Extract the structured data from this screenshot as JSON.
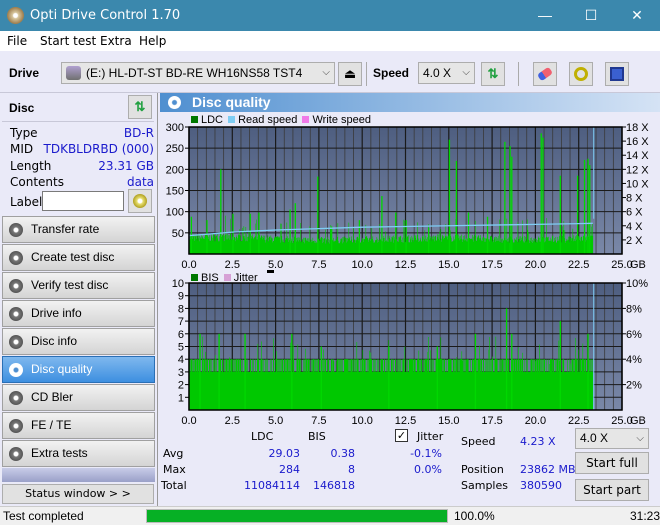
{
  "window": {
    "title": "Opti Drive Control 1.70",
    "minimize": "—",
    "maximize": "☐",
    "close": "✕"
  },
  "menu": [
    "File",
    "Start test",
    "Extra",
    "Help"
  ],
  "toolbar": {
    "drive_label": "Drive",
    "drive_value": "(E:)  HL-DT-ST BD-RE  WH16NS58 TST4",
    "speed_label": "Speed",
    "speed_value": "4.0 X",
    "icons": [
      "eject-icon",
      "refresh-icon",
      "erase-icon",
      "settings-icon",
      "save-icon"
    ]
  },
  "disc": {
    "header": "Disc",
    "type_label": "Type",
    "type_value": "BD-R",
    "mid_label": "MID",
    "mid_value": "TDKBLDRBD (000)",
    "length_label": "Length",
    "length_value": "23.31 GB",
    "contents_label": "Contents",
    "contents_value": "data",
    "label_label": "Label",
    "label_value": ""
  },
  "nav": [
    {
      "label": "Transfer rate",
      "active": false
    },
    {
      "label": "Create test disc",
      "active": false
    },
    {
      "label": "Verify test disc",
      "active": false
    },
    {
      "label": "Drive info",
      "active": false
    },
    {
      "label": "Disc info",
      "active": false
    },
    {
      "label": "Disc quality",
      "active": true
    },
    {
      "label": "CD Bler",
      "active": false
    },
    {
      "label": "FE / TE",
      "active": false
    },
    {
      "label": "Extra tests",
      "active": false
    }
  ],
  "status_window_label": "Status window > >",
  "panel_title": "Disc quality",
  "colors": {
    "ldc": "#00c800",
    "read_speed": "#7ecdf4",
    "write_speed": "#f07ae8",
    "bis": "#00c800",
    "jitter": "#d6a0d6",
    "plot_bg_top": "#4e5e80",
    "plot_bg_bottom": "#7a88a8",
    "accent": "#3d8fe0"
  },
  "chart_data": [
    {
      "type": "bar",
      "title": "LDC / Read speed",
      "legend": [
        "LDC",
        "Read speed",
        "Write speed"
      ],
      "xlabel": "GB",
      "x_ticks": [
        "0.0",
        "2.5",
        "5.0",
        "7.5",
        "10.0",
        "12.5",
        "15.0",
        "17.5",
        "20.0",
        "22.5",
        "25.0"
      ],
      "xlim": [
        0,
        25
      ],
      "ylim_left": [
        0,
        300
      ],
      "y_ticks_left": [
        "50",
        "100",
        "150",
        "200",
        "250",
        "300"
      ],
      "ylim_right": [
        0,
        18
      ],
      "y_ticks_right": [
        "2 X",
        "4 X",
        "6 X",
        "8 X",
        "10 X",
        "12 X",
        "14 X",
        "16 X",
        "18 X"
      ],
      "ldc_baseline_approx": [
        [
          0,
          38
        ],
        [
          2.5,
          40
        ],
        [
          5,
          35
        ],
        [
          7.5,
          32
        ],
        [
          10,
          34
        ],
        [
          12.5,
          36
        ],
        [
          15,
          38
        ],
        [
          17.5,
          35
        ],
        [
          20,
          34
        ],
        [
          22.5,
          36
        ],
        [
          23.31,
          36
        ]
      ],
      "ldc_spikes": [
        [
          0.1,
          88
        ],
        [
          1.0,
          80
        ],
        [
          1.8,
          200
        ],
        [
          2.5,
          95
        ],
        [
          3.5,
          95
        ],
        [
          4.0,
          98
        ],
        [
          5.8,
          105
        ],
        [
          6.1,
          120
        ],
        [
          7.4,
          183
        ],
        [
          8.2,
          65
        ],
        [
          9.8,
          80
        ],
        [
          11.1,
          137
        ],
        [
          11.9,
          98
        ],
        [
          12.5,
          80
        ],
        [
          13.8,
          62
        ],
        [
          15.0,
          270
        ],
        [
          15.4,
          220
        ],
        [
          16.1,
          98
        ],
        [
          17.2,
          88
        ],
        [
          18.2,
          265
        ],
        [
          18.5,
          255
        ],
        [
          18.6,
          230
        ],
        [
          20.3,
          285
        ],
        [
          20.4,
          275
        ],
        [
          21.4,
          185
        ],
        [
          22.4,
          185
        ],
        [
          22.8,
          222
        ],
        [
          23.0,
          225
        ],
        [
          23.1,
          210
        ]
      ],
      "read_speed_x": [
        [
          0,
          2.6
        ],
        [
          1,
          2.8
        ],
        [
          2.5,
          3.1
        ],
        [
          5,
          3.4
        ],
        [
          7.5,
          3.6
        ],
        [
          10,
          3.8
        ],
        [
          12.5,
          3.9
        ],
        [
          15,
          4.0
        ],
        [
          17.5,
          4.1
        ],
        [
          20,
          4.2
        ],
        [
          22.5,
          4.3
        ],
        [
          23.31,
          4.35
        ]
      ],
      "end_marker_gb": 23.31
    },
    {
      "type": "bar",
      "title": "BIS / Jitter",
      "legend": [
        "BIS",
        "Jitter"
      ],
      "xlabel": "GB",
      "x_ticks": [
        "0.0",
        "2.5",
        "5.0",
        "7.5",
        "10.0",
        "12.5",
        "15.0",
        "17.5",
        "20.0",
        "22.5",
        "25.0"
      ],
      "xlim": [
        0,
        25
      ],
      "ylim_left": [
        0,
        10
      ],
      "y_ticks_left": [
        "1",
        "2",
        "3",
        "4",
        "5",
        "6",
        "7",
        "8",
        "9",
        "10"
      ],
      "ylim_right": [
        0,
        10
      ],
      "y_ticks_right": [
        "2%",
        "4%",
        "6%",
        "8%",
        "10%"
      ],
      "bis_baseline_approx": 3,
      "bis_spikes": [
        [
          0.6,
          6
        ],
        [
          1.7,
          6
        ],
        [
          3.2,
          6
        ],
        [
          5.9,
          6
        ],
        [
          7.6,
          5
        ],
        [
          11.5,
          5
        ],
        [
          14.3,
          5
        ],
        [
          16.5,
          6
        ],
        [
          18.3,
          8
        ],
        [
          18.6,
          6
        ],
        [
          21.4,
          7
        ],
        [
          23.0,
          6
        ]
      ],
      "end_marker_gb": 23.31
    }
  ],
  "stats": {
    "col_ldc": "LDC",
    "col_bis": "BIS",
    "jitter_label": "Jitter",
    "jitter_checked": true,
    "avg_label": "Avg",
    "avg_ldc": "29.03",
    "avg_bis": "0.38",
    "avg_jitter": "-0.1%",
    "max_label": "Max",
    "max_ldc": "284",
    "max_bis": "8",
    "max_jitter": "0.0%",
    "total_label": "Total",
    "total_ldc": "11084114",
    "total_bis": "146818",
    "speed_label": "Speed",
    "speed_value": "4.23 X",
    "position_label": "Position",
    "position_value": "23862 MB",
    "samples_label": "Samples",
    "samples_value": "380590",
    "speed_select": "4.0 X",
    "start_full": "Start full",
    "start_part": "Start part"
  },
  "statusbar": {
    "text": "Test completed",
    "progress": 100.0,
    "progress_label": "100.0%",
    "time": "31:23"
  }
}
